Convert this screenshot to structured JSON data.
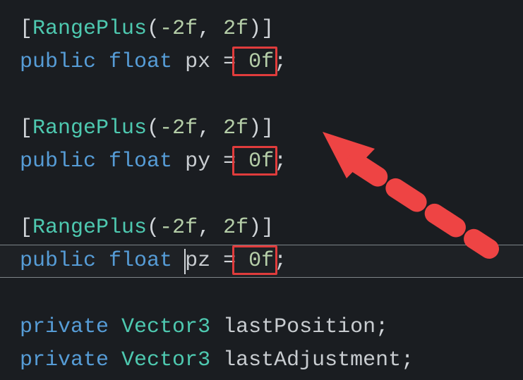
{
  "code": {
    "attr_open": "[",
    "attr_name": "RangePlus",
    "attr_paren_open": "(",
    "attr_arg1": "-2f",
    "attr_sep": ", ",
    "attr_arg2": "2f",
    "attr_paren_close": ")",
    "attr_close": "]",
    "kw_public": "public",
    "kw_private": "private",
    "kw_float": "float",
    "type_vector3": "Vector3",
    "eq": " = ",
    "val_zero": "0f",
    "semi": ";",
    "var_px": "px",
    "var_py": "py",
    "var_pz": "pz",
    "var_lastPosition": "lastPosition",
    "var_lastAdjustment": "lastAdjustment"
  },
  "annotations": {
    "highlight_color": "#e03c3c",
    "arrow_color": "#ee4444"
  }
}
